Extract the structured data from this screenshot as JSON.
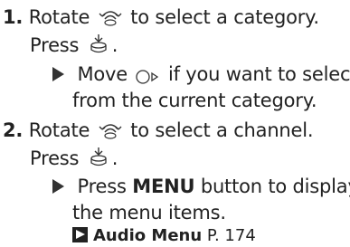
{
  "steps": [
    {
      "number": "1.",
      "line1_text": "Rotate",
      "line1_icon": "rotate-knob-icon",
      "line1_suffix": "to select a category.",
      "line2_text": "Press",
      "line2_icon": "press-knob-icon",
      "line2_suffix": ".",
      "sub_prefix": "Move",
      "sub_icon": "move-right-knob-icon",
      "sub_line1": "if you want to select",
      "sub_line2": "from the current category."
    },
    {
      "number": "2.",
      "line1_text": "Rotate",
      "line1_icon": "rotate-knob-icon",
      "line1_suffix": "to select a channel.",
      "line2_text": "Press",
      "line2_icon": "press-knob-icon",
      "line2_suffix": ".",
      "sub_prefix": "Press",
      "sub_bold": "MENU",
      "sub_line1": "button to display",
      "sub_line2": "the menu items."
    }
  ],
  "reference": {
    "icon": "reference-arrow-icon",
    "title": "Audio Menu",
    "page": "P. 174"
  }
}
